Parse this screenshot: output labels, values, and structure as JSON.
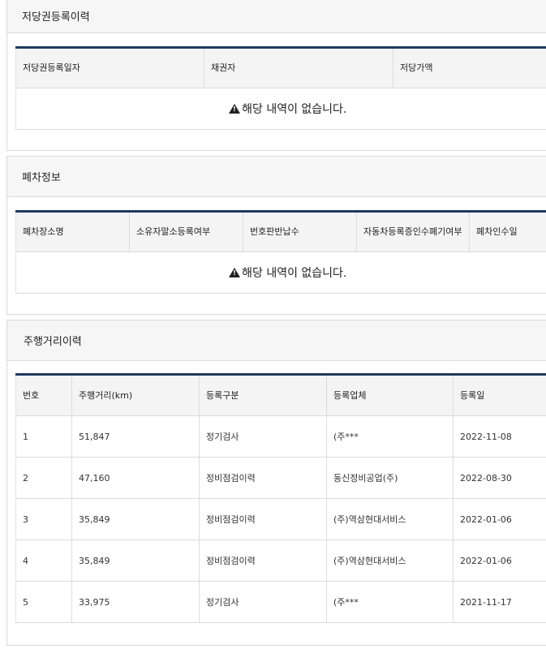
{
  "mortgage": {
    "title": "저당권등록이력",
    "columns": [
      "저당권등록일자",
      "채권자",
      "저당가액"
    ],
    "empty_text": "해당 내역이 없습니다."
  },
  "scrap": {
    "title": "폐차정보",
    "columns": [
      "폐차장소명",
      "소유자말소등록여부",
      "번호판반납수",
      "자동차등록증인수폐기여부",
      "폐차인수일"
    ],
    "empty_text": "해당 내역이 없습니다."
  },
  "mileage": {
    "title": "주행거리이력",
    "columns": [
      "번호",
      "주행거리(km)",
      "등록구분",
      "등록업체",
      "등록일"
    ],
    "rows": [
      [
        "1",
        "51,847",
        "정기검사",
        "(주***",
        "2022-11-08"
      ],
      [
        "2",
        "47,160",
        "정비점검이력",
        "동신정비공업(주)",
        "2022-08-30"
      ],
      [
        "3",
        "35,849",
        "정비점검이력",
        "(주)역삼현대서비스",
        "2022-01-06"
      ],
      [
        "4",
        "35,849",
        "정비점검이력",
        "(주)역삼현대서비스",
        "2022-01-06"
      ],
      [
        "5",
        "33,975",
        "정기검사",
        "(주***",
        "2021-11-17"
      ]
    ]
  },
  "icons": {
    "empty_notice": "warning-icon"
  }
}
